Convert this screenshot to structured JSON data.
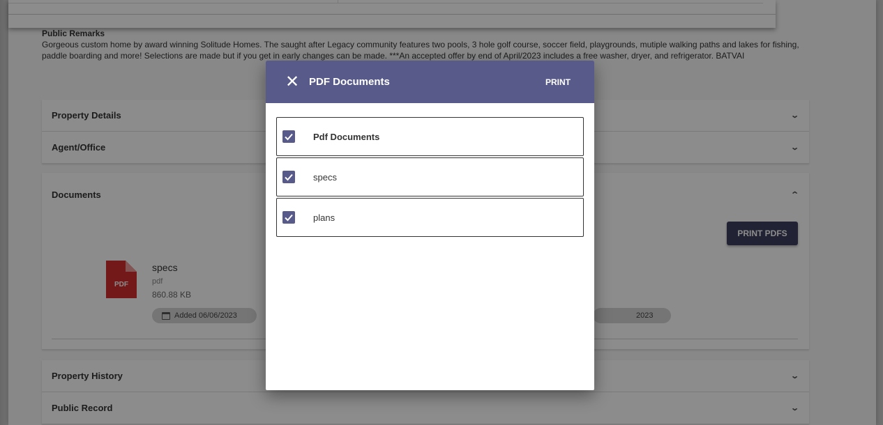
{
  "remarks": {
    "title": "Public Remarks",
    "text": "Gorgeous custom home by award winning Solitude Homes. The saught after Legacy community features two pools, 3 hole golf course, soccer field, playgrounds, mutiple walking paths and lakes for fishing, paddle boarding and more! Selections are made but if you get in early changes can be made. ***An accepted offer by end of April/2023 includes a free washer, dryer, and refrigerator. BATVAI"
  },
  "panels": {
    "property_details": "Property Details",
    "agent_office": "Agent/Office",
    "documents": "Documents",
    "property_history": "Property History",
    "public_record": "Public Record"
  },
  "documents": {
    "print_pdfs_label": "PRINT PDFS",
    "file": {
      "name": "specs",
      "type": "pdf",
      "size": "860.88 KB",
      "added": "Added 06/06/2023",
      "icon_label": "PDF"
    },
    "second_added_fragment": "2023"
  },
  "dialog": {
    "title": "PDF Documents",
    "print_label": "PRINT",
    "items": [
      {
        "label": "Pdf Documents",
        "checked": true
      },
      {
        "label": "specs",
        "checked": true
      },
      {
        "label": "plans",
        "checked": true
      }
    ]
  },
  "colors": {
    "dialog_header": "#585a8a",
    "print_pdfs_button": "#3d3f5e",
    "pdf_icon_red": "#d32f2f"
  }
}
